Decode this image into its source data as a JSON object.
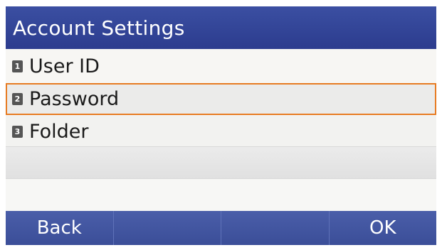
{
  "header": {
    "title": "Account Settings"
  },
  "menu": {
    "items": [
      {
        "number": "1",
        "label": "User ID"
      },
      {
        "number": "2",
        "label": "Password"
      },
      {
        "number": "3",
        "label": "Folder"
      }
    ],
    "selected_index": 1
  },
  "softkeys": {
    "items": [
      {
        "label": "Back"
      },
      {
        "label": ""
      },
      {
        "label": ""
      },
      {
        "label": "OK"
      }
    ]
  },
  "colors": {
    "title_bar": "#2f3f92",
    "selection_border": "#e77b22",
    "softkey_bar": "#4256a1"
  }
}
